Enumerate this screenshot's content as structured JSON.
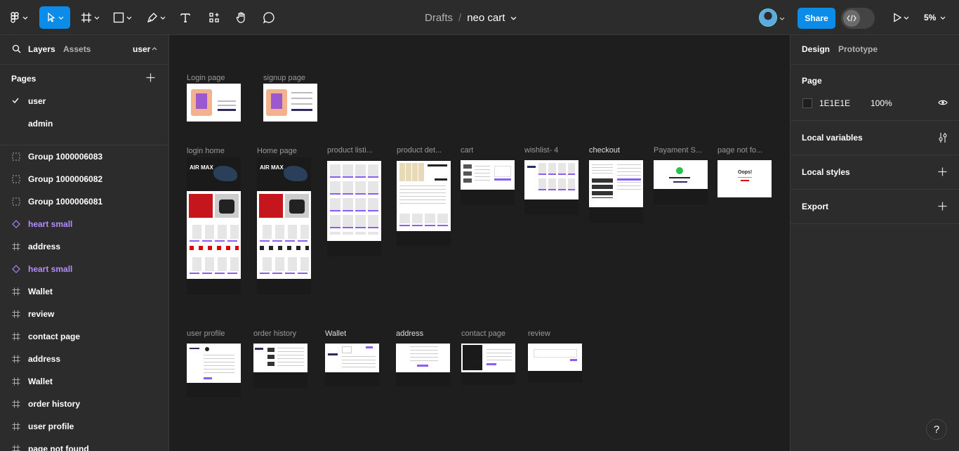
{
  "toolbar": {
    "breadcrumb_drafts": "Drafts",
    "breadcrumb_sep": "/",
    "file_name": "neo cart",
    "share_label": "Share",
    "zoom": "5%"
  },
  "left_panel": {
    "tab_layers": "Layers",
    "tab_assets": "Assets",
    "current_page": "user",
    "pages_title": "Pages",
    "pages": [
      {
        "label": "user",
        "selected": true
      },
      {
        "label": "admin",
        "selected": false
      }
    ],
    "layers": [
      {
        "label": "Group 1000006083",
        "icon": "group-icon"
      },
      {
        "label": "Group 1000006082",
        "icon": "group-icon"
      },
      {
        "label": "Group 1000006081",
        "icon": "group-icon"
      },
      {
        "label": "heart small",
        "icon": "component-icon"
      },
      {
        "label": "address",
        "icon": "frame-icon"
      },
      {
        "label": "heart small",
        "icon": "component-icon"
      },
      {
        "label": "Wallet",
        "icon": "frame-icon"
      },
      {
        "label": "review",
        "icon": "frame-icon"
      },
      {
        "label": "contact page",
        "icon": "frame-icon"
      },
      {
        "label": "address",
        "icon": "frame-icon"
      },
      {
        "label": "Wallet",
        "icon": "frame-icon"
      },
      {
        "label": "order history",
        "icon": "frame-icon"
      },
      {
        "label": "user profile",
        "icon": "frame-icon"
      },
      {
        "label": "page not found",
        "icon": "frame-icon"
      }
    ]
  },
  "right_panel": {
    "tab_design": "Design",
    "tab_prototype": "Prototype",
    "page_title": "Page",
    "bg_color_hex": "1E1E1E",
    "bg_opacity": "100%",
    "local_variables": "Local variables",
    "local_styles": "Local styles",
    "export": "Export"
  },
  "canvas": {
    "frames": [
      {
        "label": "Login page"
      },
      {
        "label": "signup page"
      },
      {
        "label": "login home"
      },
      {
        "label": "Home page"
      },
      {
        "label": "product listi..."
      },
      {
        "label": "product det..."
      },
      {
        "label": "cart"
      },
      {
        "label": "wishlist- 4"
      },
      {
        "label": "checkout"
      },
      {
        "label": "Payament S..."
      },
      {
        "label": "page not fo..."
      },
      {
        "label": "user profile"
      },
      {
        "label": "order history"
      },
      {
        "label": "Wallet"
      },
      {
        "label": "address"
      },
      {
        "label": "contact page"
      },
      {
        "label": "review"
      }
    ],
    "hero_text": "AIR MAX",
    "oops_text": "Oops!"
  },
  "colors": {
    "accent": "#0c8ce9",
    "component": "#b38cff",
    "canvas_bg": "#1e1e1e",
    "panel_bg": "#2c2c2c"
  },
  "help_label": "?"
}
